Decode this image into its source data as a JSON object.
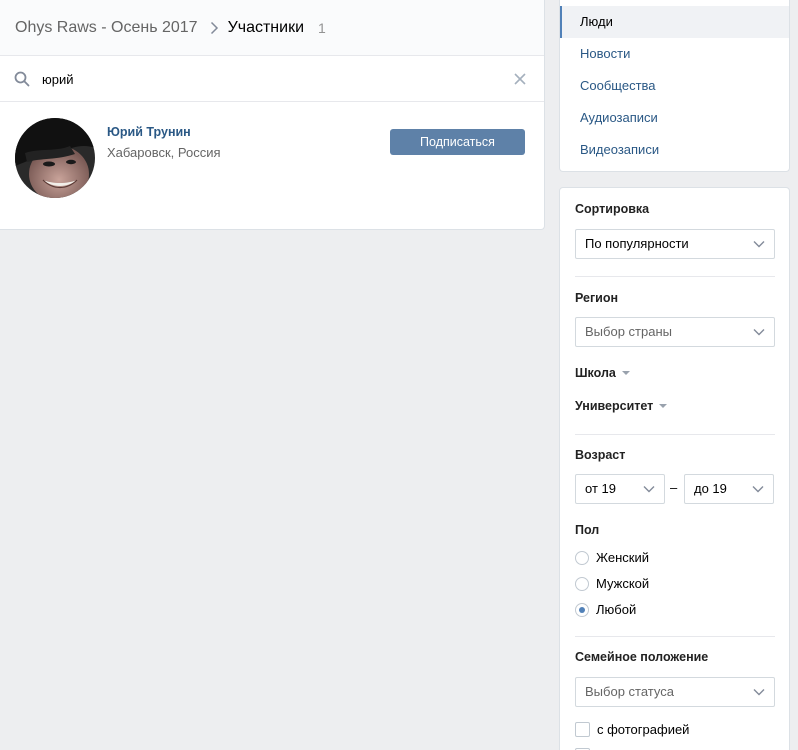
{
  "header": {
    "group_name": "Ohys Raws - Осень 2017",
    "current_section": "Участники",
    "count": "1"
  },
  "search": {
    "query": "юрий"
  },
  "results": [
    {
      "name": "Юрий Трунин",
      "location": "Хабаровск, Россия",
      "action_label": "Подписаться"
    }
  ],
  "nav": {
    "items": [
      {
        "label": "Люди",
        "active": true
      },
      {
        "label": "Новости"
      },
      {
        "label": "Сообщества"
      },
      {
        "label": "Аудиозаписи"
      },
      {
        "label": "Видеозаписи"
      }
    ]
  },
  "filters": {
    "sort": {
      "label": "Сортировка",
      "value": "По популярности"
    },
    "region": {
      "label": "Регион",
      "placeholder": "Выбор страны"
    },
    "school": {
      "label": "Школа"
    },
    "university": {
      "label": "Университет"
    },
    "age": {
      "label": "Возраст",
      "from": "от 19",
      "separator": "–",
      "to": "до 19"
    },
    "gender": {
      "label": "Пол",
      "options": [
        "Женский",
        "Мужской",
        "Любой"
      ],
      "selected": "Любой"
    },
    "marital": {
      "label": "Семейное положение",
      "placeholder": "Выбор статуса"
    },
    "with_photo": {
      "label": "с фотографией"
    }
  },
  "colors": {
    "link": "#2a5885",
    "button": "#5e81a8",
    "accent": "#5181b8",
    "background": "#edeef0"
  }
}
